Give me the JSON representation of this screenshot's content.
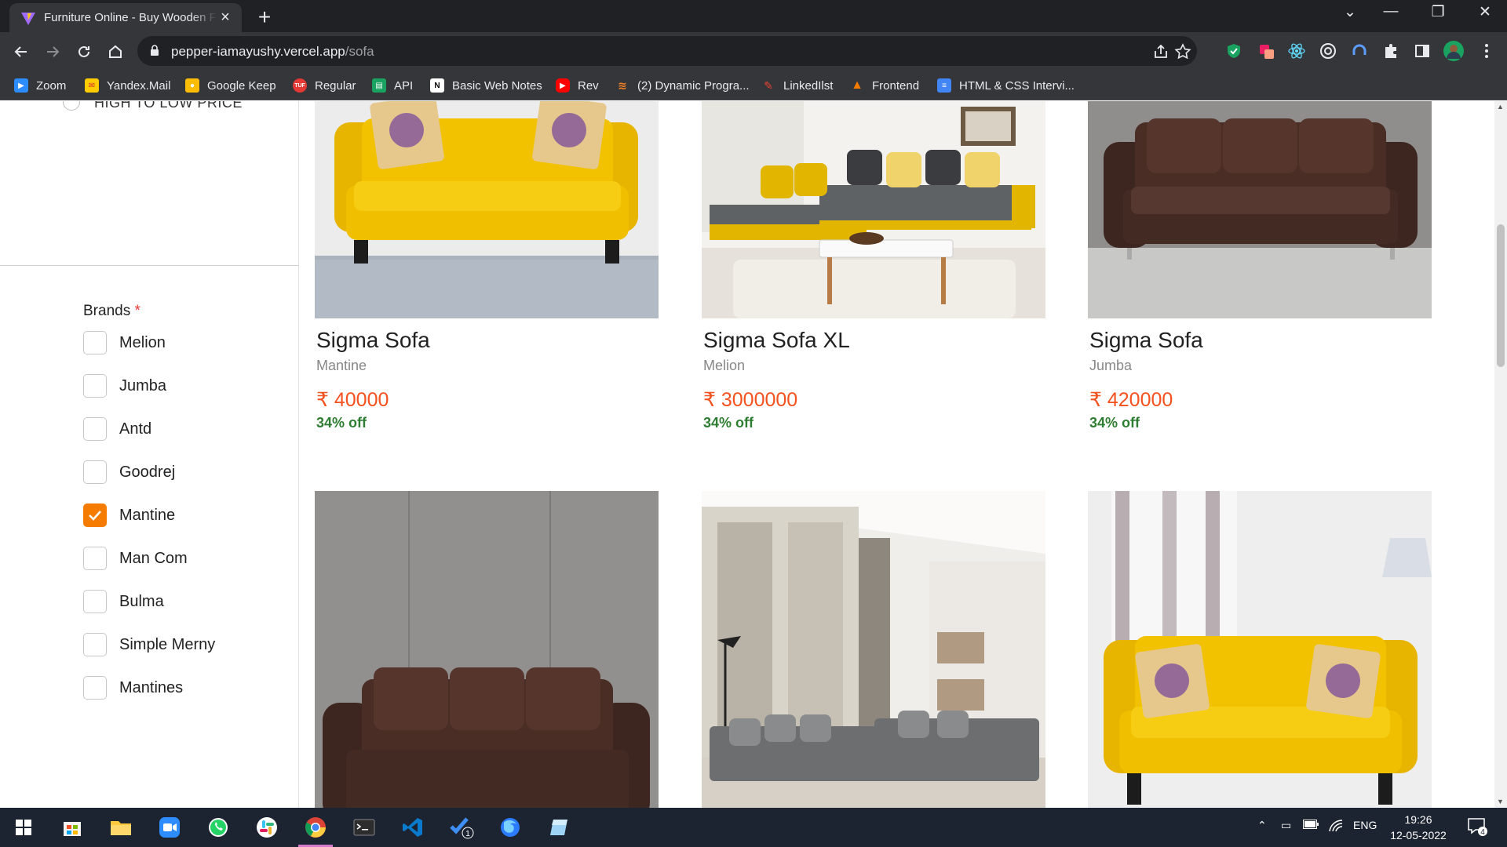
{
  "browser": {
    "tab_title": "Furniture Online - Buy Wooden Furniture",
    "url_host": "pepper-iamayushy.vercel.app",
    "url_path": "/sofa",
    "new_tab_label": "+",
    "bookmarks": [
      {
        "label": "Zoom",
        "icon": "zoom-icon",
        "color": "#2d8cff"
      },
      {
        "label": "Yandex.Mail",
        "icon": "mail-icon",
        "color": "#ffcc00"
      },
      {
        "label": "Google Keep",
        "icon": "keep-icon",
        "color": "#fbbc04"
      },
      {
        "label": "Regular",
        "icon": "tuf-icon",
        "color": "#e53935"
      },
      {
        "label": "API",
        "icon": "api-icon",
        "color": "#1aa260"
      },
      {
        "label": "Basic Web Notes",
        "icon": "notion-icon",
        "color": "#ffffff"
      },
      {
        "label": "Rev",
        "icon": "youtube-icon",
        "color": "#ff0000"
      },
      {
        "label": "(2) Dynamic Progra...",
        "icon": "stack-icon",
        "color": "#f48024"
      },
      {
        "label": "LinkedIlst",
        "icon": "linked-icon",
        "color": "#ea4335"
      },
      {
        "label": "Frontend",
        "icon": "frontend-icon",
        "color": "#f57c00"
      },
      {
        "label": "HTML & CSS Intervi...",
        "icon": "docs-icon",
        "color": "#4285f4"
      }
    ]
  },
  "sidebar": {
    "sort_option_label": "HIGH TO LOW PRICE",
    "brands_title": "Brands",
    "required_mark": "*",
    "brands": [
      {
        "label": "Melion",
        "checked": false
      },
      {
        "label": "Jumba",
        "checked": false
      },
      {
        "label": "Antd",
        "checked": false
      },
      {
        "label": "Goodrej",
        "checked": false
      },
      {
        "label": "Mantine",
        "checked": true
      },
      {
        "label": "Man Com",
        "checked": false
      },
      {
        "label": "Bulma",
        "checked": false
      },
      {
        "label": "Simple Merny",
        "checked": false
      },
      {
        "label": "Mantines",
        "checked": false
      }
    ]
  },
  "products": [
    {
      "name": "Sigma Sofa",
      "brand": "Mantine",
      "price": "₹ 40000",
      "discount": "34% off",
      "image": "yellow-sofa"
    },
    {
      "name": "Sigma Sofa XL",
      "brand": "Melion",
      "price": "₹ 3000000",
      "discount": "34% off",
      "image": "sectional-sofa"
    },
    {
      "name": "Sigma Sofa",
      "brand": "Jumba",
      "price": "₹ 420000",
      "discount": "34% off",
      "image": "brown-sofa"
    },
    {
      "image": "brown-sofa-2"
    },
    {
      "image": "grey-sectional"
    },
    {
      "image": "yellow-sofa-2"
    }
  ],
  "taskbar": {
    "language": "ENG",
    "time": "19:26",
    "date": "12-05-2022",
    "notification_count": "4",
    "todo_badge": "1"
  }
}
